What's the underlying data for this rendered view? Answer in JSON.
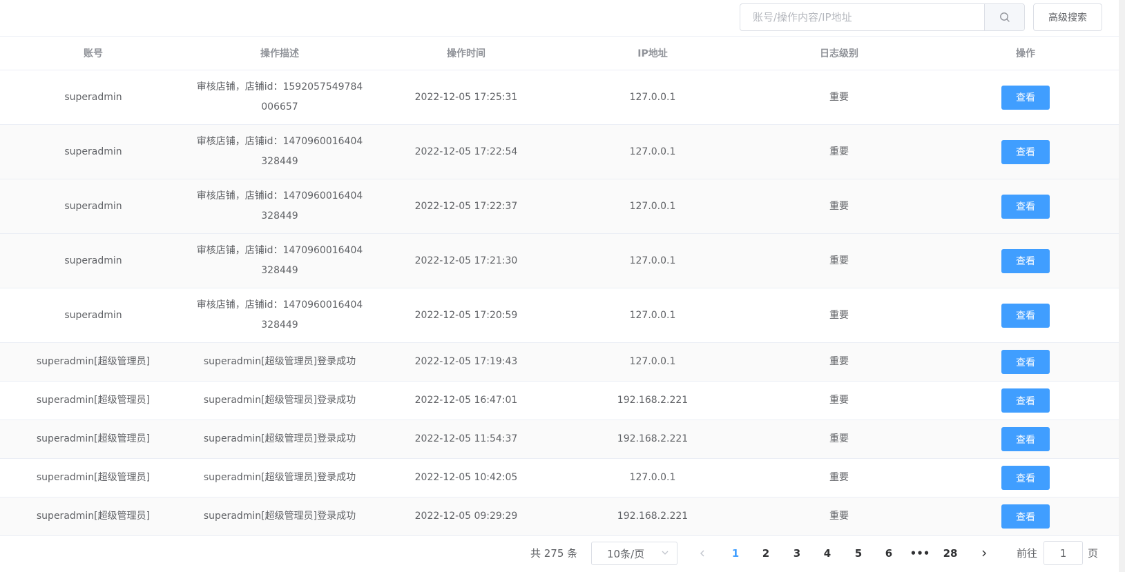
{
  "toolbar": {
    "search_placeholder": "账号/操作内容/IP地址",
    "search_icon": "search-icon",
    "advanced_search_label": "高级搜索"
  },
  "table": {
    "headers": [
      "账号",
      "操作描述",
      "操作时间",
      "IP地址",
      "日志级别",
      "操作"
    ],
    "rows": [
      {
        "account": "superadmin",
        "desc": "审核店铺，店铺id：1592057549784006657",
        "time": "2022-12-05 17:25:31",
        "ip": "127.0.0.1",
        "level": "重要",
        "action": "查看"
      },
      {
        "account": "superadmin",
        "desc": "审核店铺，店铺id：1470960016404328449",
        "time": "2022-12-05 17:22:54",
        "ip": "127.0.0.1",
        "level": "重要",
        "action": "查看"
      },
      {
        "account": "superadmin",
        "desc": "审核店铺，店铺id：1470960016404328449",
        "time": "2022-12-05 17:22:37",
        "ip": "127.0.0.1",
        "level": "重要",
        "action": "查看"
      },
      {
        "account": "superadmin",
        "desc": "审核店铺，店铺id：1470960016404328449",
        "time": "2022-12-05 17:21:30",
        "ip": "127.0.0.1",
        "level": "重要",
        "action": "查看"
      },
      {
        "account": "superadmin",
        "desc": "审核店铺，店铺id：1470960016404328449",
        "time": "2022-12-05 17:20:59",
        "ip": "127.0.0.1",
        "level": "重要",
        "action": "查看"
      },
      {
        "account": "superadmin[超级管理员]",
        "desc": "superadmin[超级管理员]登录成功",
        "time": "2022-12-05 17:19:43",
        "ip": "127.0.0.1",
        "level": "重要",
        "action": "查看"
      },
      {
        "account": "superadmin[超级管理员]",
        "desc": "superadmin[超级管理员]登录成功",
        "time": "2022-12-05 16:47:01",
        "ip": "192.168.2.221",
        "level": "重要",
        "action": "查看"
      },
      {
        "account": "superadmin[超级管理员]",
        "desc": "superadmin[超级管理员]登录成功",
        "time": "2022-12-05 11:54:37",
        "ip": "192.168.2.221",
        "level": "重要",
        "action": "查看"
      },
      {
        "account": "superadmin[超级管理员]",
        "desc": "superadmin[超级管理员]登录成功",
        "time": "2022-12-05 10:42:05",
        "ip": "127.0.0.1",
        "level": "重要",
        "action": "查看"
      },
      {
        "account": "superadmin[超级管理员]",
        "desc": "superadmin[超级管理员]登录成功",
        "time": "2022-12-05 09:29:29",
        "ip": "192.168.2.221",
        "level": "重要",
        "action": "查看"
      }
    ]
  },
  "pagination": {
    "total_label": "共 275 条",
    "page_size_label": "10条/页",
    "pages": [
      "1",
      "2",
      "3",
      "4",
      "5",
      "6",
      "•••",
      "28"
    ],
    "current_page": "1",
    "goto_prefix": "前往",
    "goto_value": "1",
    "goto_suffix": "页",
    "prev_icon": "chevron-left-icon",
    "next_icon": "chevron-right-icon"
  },
  "colors": {
    "primary": "#409eff",
    "border": "#ebeef5",
    "stripe": "#fafafa"
  }
}
